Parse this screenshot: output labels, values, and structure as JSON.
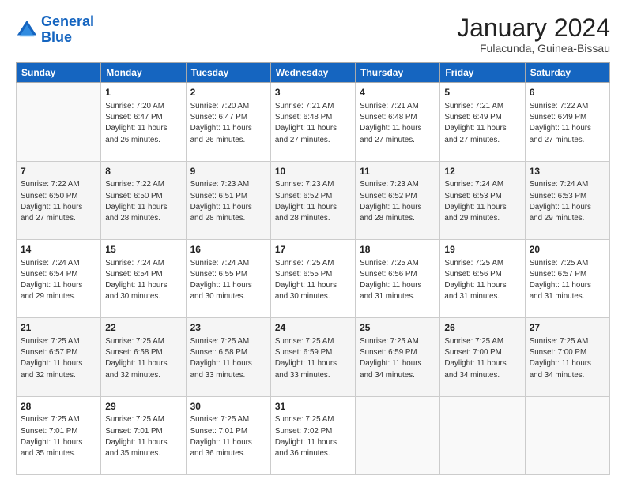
{
  "header": {
    "logo_line1": "General",
    "logo_line2": "Blue",
    "title": "January 2024",
    "subtitle": "Fulacunda, Guinea-Bissau"
  },
  "days_of_week": [
    "Sunday",
    "Monday",
    "Tuesday",
    "Wednesday",
    "Thursday",
    "Friday",
    "Saturday"
  ],
  "weeks": [
    [
      {
        "day": "",
        "info": ""
      },
      {
        "day": "1",
        "info": "Sunrise: 7:20 AM\nSunset: 6:47 PM\nDaylight: 11 hours\nand 26 minutes."
      },
      {
        "day": "2",
        "info": "Sunrise: 7:20 AM\nSunset: 6:47 PM\nDaylight: 11 hours\nand 26 minutes."
      },
      {
        "day": "3",
        "info": "Sunrise: 7:21 AM\nSunset: 6:48 PM\nDaylight: 11 hours\nand 27 minutes."
      },
      {
        "day": "4",
        "info": "Sunrise: 7:21 AM\nSunset: 6:48 PM\nDaylight: 11 hours\nand 27 minutes."
      },
      {
        "day": "5",
        "info": "Sunrise: 7:21 AM\nSunset: 6:49 PM\nDaylight: 11 hours\nand 27 minutes."
      },
      {
        "day": "6",
        "info": "Sunrise: 7:22 AM\nSunset: 6:49 PM\nDaylight: 11 hours\nand 27 minutes."
      }
    ],
    [
      {
        "day": "7",
        "info": "Sunrise: 7:22 AM\nSunset: 6:50 PM\nDaylight: 11 hours\nand 27 minutes."
      },
      {
        "day": "8",
        "info": "Sunrise: 7:22 AM\nSunset: 6:50 PM\nDaylight: 11 hours\nand 28 minutes."
      },
      {
        "day": "9",
        "info": "Sunrise: 7:23 AM\nSunset: 6:51 PM\nDaylight: 11 hours\nand 28 minutes."
      },
      {
        "day": "10",
        "info": "Sunrise: 7:23 AM\nSunset: 6:52 PM\nDaylight: 11 hours\nand 28 minutes."
      },
      {
        "day": "11",
        "info": "Sunrise: 7:23 AM\nSunset: 6:52 PM\nDaylight: 11 hours\nand 28 minutes."
      },
      {
        "day": "12",
        "info": "Sunrise: 7:24 AM\nSunset: 6:53 PM\nDaylight: 11 hours\nand 29 minutes."
      },
      {
        "day": "13",
        "info": "Sunrise: 7:24 AM\nSunset: 6:53 PM\nDaylight: 11 hours\nand 29 minutes."
      }
    ],
    [
      {
        "day": "14",
        "info": "Sunrise: 7:24 AM\nSunset: 6:54 PM\nDaylight: 11 hours\nand 29 minutes."
      },
      {
        "day": "15",
        "info": "Sunrise: 7:24 AM\nSunset: 6:54 PM\nDaylight: 11 hours\nand 30 minutes."
      },
      {
        "day": "16",
        "info": "Sunrise: 7:24 AM\nSunset: 6:55 PM\nDaylight: 11 hours\nand 30 minutes."
      },
      {
        "day": "17",
        "info": "Sunrise: 7:25 AM\nSunset: 6:55 PM\nDaylight: 11 hours\nand 30 minutes."
      },
      {
        "day": "18",
        "info": "Sunrise: 7:25 AM\nSunset: 6:56 PM\nDaylight: 11 hours\nand 31 minutes."
      },
      {
        "day": "19",
        "info": "Sunrise: 7:25 AM\nSunset: 6:56 PM\nDaylight: 11 hours\nand 31 minutes."
      },
      {
        "day": "20",
        "info": "Sunrise: 7:25 AM\nSunset: 6:57 PM\nDaylight: 11 hours\nand 31 minutes."
      }
    ],
    [
      {
        "day": "21",
        "info": "Sunrise: 7:25 AM\nSunset: 6:57 PM\nDaylight: 11 hours\nand 32 minutes."
      },
      {
        "day": "22",
        "info": "Sunrise: 7:25 AM\nSunset: 6:58 PM\nDaylight: 11 hours\nand 32 minutes."
      },
      {
        "day": "23",
        "info": "Sunrise: 7:25 AM\nSunset: 6:58 PM\nDaylight: 11 hours\nand 33 minutes."
      },
      {
        "day": "24",
        "info": "Sunrise: 7:25 AM\nSunset: 6:59 PM\nDaylight: 11 hours\nand 33 minutes."
      },
      {
        "day": "25",
        "info": "Sunrise: 7:25 AM\nSunset: 6:59 PM\nDaylight: 11 hours\nand 34 minutes."
      },
      {
        "day": "26",
        "info": "Sunrise: 7:25 AM\nSunset: 7:00 PM\nDaylight: 11 hours\nand 34 minutes."
      },
      {
        "day": "27",
        "info": "Sunrise: 7:25 AM\nSunset: 7:00 PM\nDaylight: 11 hours\nand 34 minutes."
      }
    ],
    [
      {
        "day": "28",
        "info": "Sunrise: 7:25 AM\nSunset: 7:01 PM\nDaylight: 11 hours\nand 35 minutes."
      },
      {
        "day": "29",
        "info": "Sunrise: 7:25 AM\nSunset: 7:01 PM\nDaylight: 11 hours\nand 35 minutes."
      },
      {
        "day": "30",
        "info": "Sunrise: 7:25 AM\nSunset: 7:01 PM\nDaylight: 11 hours\nand 36 minutes."
      },
      {
        "day": "31",
        "info": "Sunrise: 7:25 AM\nSunset: 7:02 PM\nDaylight: 11 hours\nand 36 minutes."
      },
      {
        "day": "",
        "info": ""
      },
      {
        "day": "",
        "info": ""
      },
      {
        "day": "",
        "info": ""
      }
    ]
  ]
}
